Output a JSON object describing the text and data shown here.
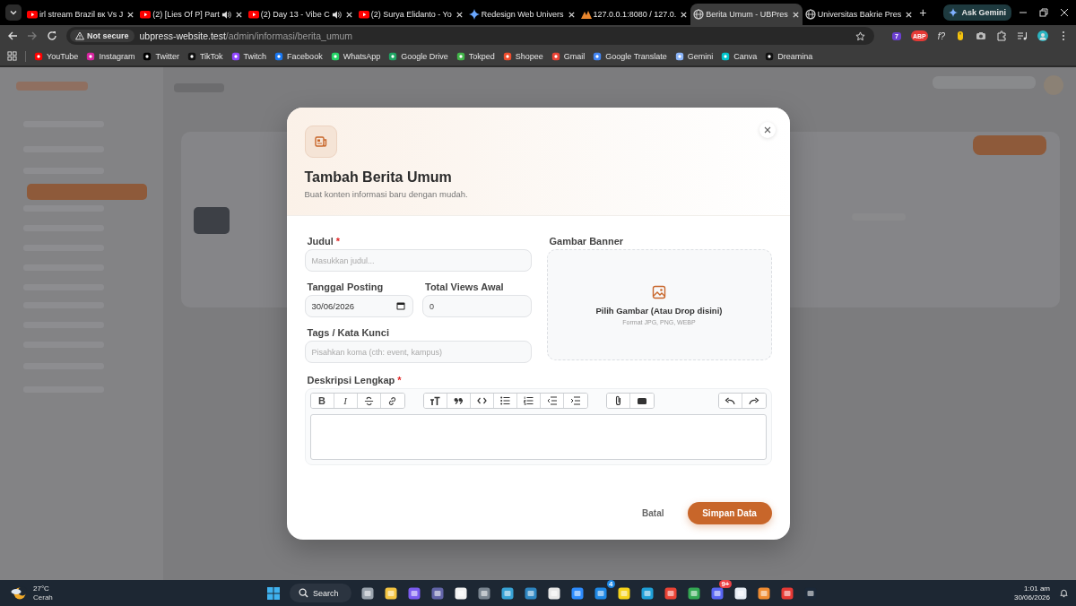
{
  "browser": {
    "tabs": [
      {
        "title": "irl stream Brazil вк Vs J",
        "audio": false,
        "selected": false
      },
      {
        "title": "(2) [Lies Of P] Part",
        "audio": true,
        "selected": false
      },
      {
        "title": "(2) Day 13 - Vibe C",
        "audio": true,
        "selected": false
      },
      {
        "title": "(2) Surya Elidanto - Yo",
        "audio": false,
        "selected": false
      },
      {
        "title": "Redesign Web Univers",
        "audio": false,
        "selected": false
      },
      {
        "title": "127.0.0.1:8080 / 127.0.",
        "audio": false,
        "selected": false
      },
      {
        "title": "Berita Umum - UBPres",
        "audio": false,
        "selected": true
      },
      {
        "title": "Universitas Bakrie Pres",
        "audio": false,
        "selected": false
      }
    ],
    "new_tab": "+",
    "ask_gemini": "Ask Gemini",
    "security": "Not secure",
    "url_host": "ubpress-website.test",
    "url_path": "/admin/informasi/berita_umum",
    "extension_badge": "7",
    "adblock_label": "ABP",
    "fx_label": "f?"
  },
  "bookmarks": [
    "YouTube",
    "Instagram",
    "Twitter",
    "TikTok",
    "Twitch",
    "Facebook",
    "WhatsApp",
    "Google Drive",
    "Tokped",
    "Shopee",
    "Gmail",
    "Google Translate",
    "Gemini",
    "Canva",
    "Dreamina"
  ],
  "modal": {
    "title": "Tambah Berita Umum",
    "subtitle": "Buat konten informasi baru dengan mudah.",
    "judul": {
      "label": "Judul",
      "required_mark": "*",
      "placeholder": "Masukkan judul..."
    },
    "tanggal": {
      "label": "Tanggal Posting",
      "value": "30/06/2026"
    },
    "views": {
      "label": "Total Views Awal",
      "value": "0"
    },
    "tags": {
      "label": "Tags / Kata Kunci",
      "placeholder": "Pisahkan koma (cth: event, kampus)"
    },
    "banner": {
      "label": "Gambar Banner",
      "prompt": "Pilih Gambar (Atau Drop disini)",
      "formats": "Format JPG, PNG, WEBP"
    },
    "deskripsi": {
      "label": "Deskripsi Lengkap",
      "required_mark": "*",
      "bold_label": "B",
      "italic_label": "I"
    },
    "cancel": "Batal",
    "save": "Simpan Data"
  },
  "taskbar": {
    "temperature": "27°C",
    "weather": "Cerah",
    "search": "Search",
    "badges": [
      "4",
      "9+"
    ],
    "time": "1:01 am",
    "date": "30/06/2026"
  }
}
